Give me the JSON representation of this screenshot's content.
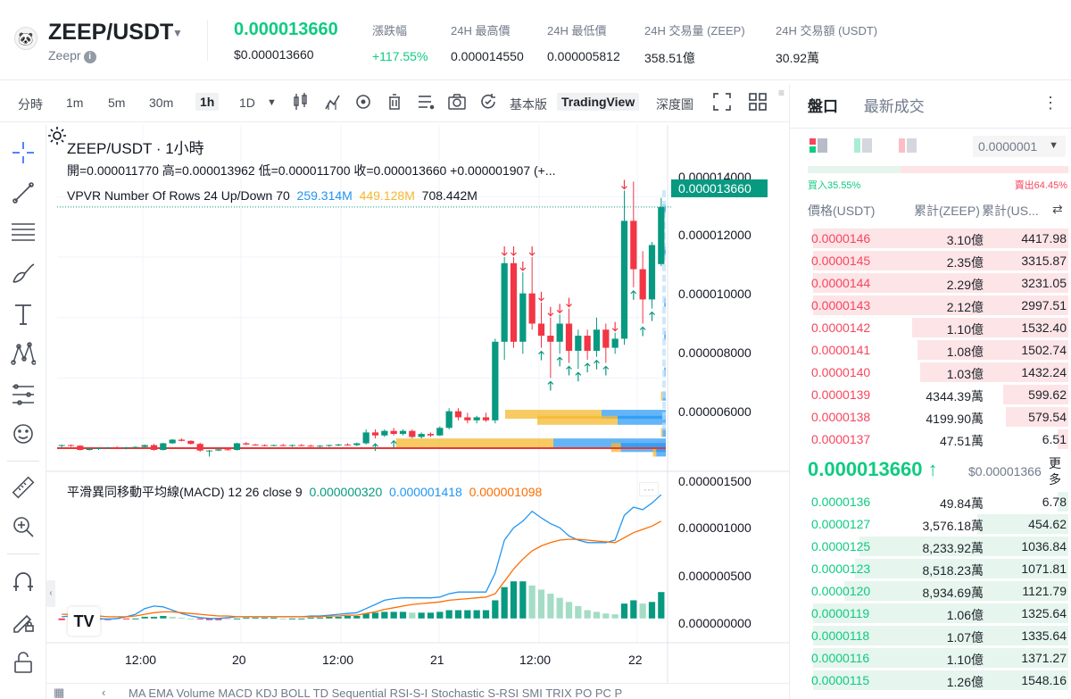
{
  "header": {
    "pair": "ZEEP/USDT",
    "sub": "Zeepr",
    "last_price": "0.000013660",
    "last_usd": "$0.000013660",
    "stats": [
      {
        "label": "漲跌幅",
        "value": "+117.55%",
        "green": true
      },
      {
        "label": "24H 最高價",
        "value": "0.000014550"
      },
      {
        "label": "24H 最低價",
        "value": "0.000005812"
      },
      {
        "label": "24H 交易量 (ZEEP)",
        "value": "358.51億"
      },
      {
        "label": "24H 交易額 (USDT)",
        "value": "30.92萬"
      }
    ]
  },
  "toolbar": {
    "intervals": [
      "分時",
      "1m",
      "5m",
      "30m",
      "1h",
      "1D"
    ],
    "active": "1h",
    "basic": "基本版",
    "tradingview": "TradingView",
    "depth": "深度圖"
  },
  "chart": {
    "title": "ZEEP/USDT · 1小時",
    "ohlc": "開=0.000011770  高=0.000013962  低=0.000011700  收=0.000013660  +0.000001907  (+...",
    "vpvr_label": "VPVR Number Of Rows 24 Up/Down 70",
    "vpvr_up": "259.314M",
    "vpvr_down": "449.128M",
    "vpvr_total": "708.442M",
    "last_tag": "0.000013660",
    "price_axis": [
      "0.000014000",
      "0.000012000",
      "0.000010000",
      "0.000008000",
      "0.000006000"
    ],
    "macd_label": "平滑異同移動平均線(MACD) 12 26 close 9",
    "macd_v1": "0.000000320",
    "macd_v2": "0.000001418",
    "macd_v3": "0.000001098",
    "macd_axis": [
      "0.000001500",
      "0.000001000",
      "0.000000500",
      "0.000000000"
    ],
    "time_axis": [
      "12:00",
      "20",
      "12:00",
      "21",
      "12:00",
      "22"
    ]
  },
  "indicators": "MA   EMA   Volume   MACD   KDJ   BOLL   TD Sequential   RSI-S-I   Stochastic   S-RSI   SMI   TRIX   PO   PC   P",
  "orderbook": {
    "tabs": [
      "盤口",
      "最新成交"
    ],
    "precision": "0.0000001",
    "buy_ratio": "買入35.55%",
    "sell_ratio": "賣出64.45%",
    "cols": {
      "price": "價格(USDT)",
      "amount": "累計(ZEEP)",
      "total": "累計(US..."
    },
    "asks": [
      {
        "p": "0.0000146",
        "a": "3.10億",
        "t": "4417.98",
        "w": 0.98
      },
      {
        "p": "0.0000145",
        "a": "2.35億",
        "t": "3315.87",
        "w": 0.98
      },
      {
        "p": "0.0000144",
        "a": "2.29億",
        "t": "3231.05",
        "w": 0.98
      },
      {
        "p": "0.0000143",
        "a": "2.12億",
        "t": "2997.51",
        "w": 0.98
      },
      {
        "p": "0.0000142",
        "a": "1.10億",
        "t": "1532.40",
        "w": 0.6
      },
      {
        "p": "0.0000141",
        "a": "1.08億",
        "t": "1502.74",
        "w": 0.58
      },
      {
        "p": "0.0000140",
        "a": "1.03億",
        "t": "1432.24",
        "w": 0.57
      },
      {
        "p": "0.0000139",
        "a": "4344.39萬",
        "t": "599.62",
        "w": 0.25
      },
      {
        "p": "0.0000138",
        "a": "4199.90萬",
        "t": "579.54",
        "w": 0.24
      },
      {
        "p": "0.0000137",
        "a": "47.51萬",
        "t": "6.51",
        "w": 0.04
      }
    ],
    "mid_price": "0.000013660 ↑",
    "mid_usd": "$0.00001366",
    "mid_more": "更多",
    "bids": [
      {
        "p": "0.0000136",
        "a": "49.84萬",
        "t": "6.78",
        "w": 0.04
      },
      {
        "p": "0.0000127",
        "a": "3,576.18萬",
        "t": "454.62",
        "w": 0.35
      },
      {
        "p": "0.0000125",
        "a": "8,233.92萬",
        "t": "1036.84",
        "w": 0.8
      },
      {
        "p": "0.0000123",
        "a": "8,518.23萬",
        "t": "1071.81",
        "w": 0.82
      },
      {
        "p": "0.0000120",
        "a": "8,934.69萬",
        "t": "1121.79",
        "w": 0.86
      },
      {
        "p": "0.0000119",
        "a": "1.06億",
        "t": "1325.64",
        "w": 0.98
      },
      {
        "p": "0.0000118",
        "a": "1.07億",
        "t": "1335.64",
        "w": 0.98
      },
      {
        "p": "0.0000116",
        "a": "1.10億",
        "t": "1371.27",
        "w": 0.98
      },
      {
        "p": "0.0000115",
        "a": "1.26億",
        "t": "1548.16",
        "w": 0.98
      }
    ]
  },
  "colors": {
    "up": "#0ecb81",
    "down": "#f6465d",
    "tv_up": "#089981",
    "tv_down": "#f23645"
  },
  "chart_data": {
    "type": "candlestick",
    "series": [
      {
        "name": "price",
        "values": [
          [
            5.75,
            5.8,
            5.7,
            5.78
          ],
          [
            5.78,
            5.8,
            5.72,
            5.76
          ],
          [
            5.76,
            5.78,
            5.6,
            5.62
          ],
          [
            5.62,
            5.68,
            5.6,
            5.66
          ],
          [
            5.66,
            5.7,
            5.62,
            5.68
          ],
          [
            5.68,
            5.72,
            5.66,
            5.7
          ],
          [
            5.7,
            5.74,
            5.66,
            5.68
          ],
          [
            5.68,
            5.72,
            5.64,
            5.7
          ],
          [
            5.7,
            5.74,
            5.68,
            5.72
          ],
          [
            5.72,
            5.8,
            5.7,
            5.78
          ],
          [
            5.78,
            5.82,
            5.6,
            5.62
          ],
          [
            5.62,
            5.86,
            5.6,
            5.84
          ],
          [
            5.84,
            5.98,
            5.82,
            5.96
          ],
          [
            5.96,
            6.0,
            5.9,
            5.92
          ],
          [
            5.92,
            5.94,
            5.8,
            5.82
          ],
          [
            5.82,
            5.86,
            5.56,
            5.6
          ],
          [
            5.6,
            5.62,
            5.4,
            5.6
          ],
          [
            5.6,
            5.66,
            5.58,
            5.64
          ],
          [
            5.64,
            5.66,
            5.6,
            5.62
          ],
          [
            5.62,
            5.86,
            5.6,
            5.84
          ],
          [
            5.84,
            5.88,
            5.78,
            5.8
          ],
          [
            5.8,
            5.82,
            5.76,
            5.78
          ],
          [
            5.78,
            5.8,
            5.74,
            5.76
          ],
          [
            5.76,
            5.8,
            5.74,
            5.78
          ],
          [
            5.78,
            5.82,
            5.74,
            5.76
          ],
          [
            5.76,
            5.8,
            5.72,
            5.78
          ],
          [
            5.78,
            5.82,
            5.74,
            5.76
          ],
          [
            5.76,
            5.8,
            5.72,
            5.74
          ],
          [
            5.74,
            5.78,
            5.7,
            5.76
          ],
          [
            5.76,
            5.8,
            5.72,
            5.78
          ],
          [
            5.78,
            5.82,
            5.74,
            5.8
          ],
          [
            5.8,
            5.84,
            5.76,
            5.78
          ],
          [
            5.78,
            5.86,
            5.74,
            5.84
          ],
          [
            5.84,
            6.3,
            5.8,
            6.2
          ],
          [
            6.2,
            6.3,
            6.0,
            6.1
          ],
          [
            6.1,
            6.3,
            6.05,
            6.25
          ],
          [
            6.25,
            6.35,
            6.1,
            6.15
          ],
          [
            6.15,
            6.3,
            6.1,
            6.25
          ],
          [
            6.25,
            6.3,
            6.0,
            6.05
          ],
          [
            6.05,
            6.2,
            6.0,
            6.15
          ],
          [
            6.15,
            6.2,
            6.05,
            6.1
          ],
          [
            6.1,
            6.4,
            6.08,
            6.35
          ],
          [
            6.35,
            7.0,
            6.3,
            6.9
          ],
          [
            6.9,
            7.0,
            6.6,
            6.7
          ],
          [
            6.7,
            6.85,
            6.5,
            6.6
          ],
          [
            6.6,
            6.75,
            6.5,
            6.7
          ],
          [
            6.7,
            6.85,
            6.55,
            6.6
          ],
          [
            6.6,
            9.3,
            6.5,
            9.2
          ],
          [
            9.2,
            12.0,
            8.6,
            11.8
          ],
          [
            11.8,
            12.0,
            9.0,
            9.2
          ],
          [
            9.2,
            11.5,
            8.8,
            10.8
          ],
          [
            10.8,
            12.0,
            9.6,
            9.8
          ],
          [
            9.8,
            10.5,
            9.0,
            9.4
          ],
          [
            9.4,
            10.0,
            8.0,
            9.2
          ],
          [
            9.2,
            10.1,
            8.8,
            9.8
          ],
          [
            9.8,
            10.3,
            8.5,
            8.9
          ],
          [
            8.9,
            9.6,
            8.3,
            9.4
          ],
          [
            9.4,
            9.6,
            8.6,
            8.9
          ],
          [
            8.9,
            10.0,
            8.7,
            9.6
          ],
          [
            9.6,
            9.8,
            8.5,
            9.0
          ],
          [
            9.0,
            9.5,
            8.8,
            9.3
          ],
          [
            9.3,
            14.2,
            9.1,
            13.2
          ],
          [
            13.2,
            14.5,
            11.0,
            11.6
          ],
          [
            11.6,
            12.2,
            9.8,
            10.6
          ],
          [
            10.6,
            12.5,
            10.3,
            12.4
          ],
          [
            11.77,
            13.96,
            11.7,
            13.66
          ]
        ]
      }
    ],
    "macd": {
      "hist": [
        -0.02,
        -0.02,
        -0.03,
        -0.03,
        -0.02,
        -0.02,
        -0.01,
        -0.01,
        0.0,
        0.02,
        0.02,
        0.03,
        0.02,
        0.01,
        0.0,
        -0.01,
        -0.02,
        -0.02,
        -0.01,
        0.0,
        0.01,
        0.01,
        0.01,
        0.01,
        0.0,
        0.0,
        0.0,
        0.01,
        0.01,
        0.02,
        0.02,
        0.03,
        0.03,
        0.06,
        0.07,
        0.08,
        0.08,
        0.08,
        0.07,
        0.07,
        0.07,
        0.08,
        0.1,
        0.1,
        0.1,
        0.1,
        0.1,
        0.22,
        0.38,
        0.45,
        0.45,
        0.4,
        0.35,
        0.3,
        0.25,
        0.2,
        0.15,
        0.1,
        0.08,
        0.06,
        0.05,
        0.18,
        0.22,
        0.18,
        0.2,
        0.32
      ],
      "macd_line": [
        0.02,
        0.03,
        0.02,
        0.01,
        0.0,
        -0.01,
        0.0,
        0.02,
        0.05,
        0.12,
        0.15,
        0.14,
        0.1,
        0.06,
        0.03,
        0.01,
        0.0,
        0.0,
        0.01,
        0.02,
        0.02,
        0.02,
        0.02,
        0.02,
        0.02,
        0.02,
        0.02,
        0.03,
        0.03,
        0.04,
        0.05,
        0.06,
        0.07,
        0.12,
        0.17,
        0.22,
        0.24,
        0.25,
        0.25,
        0.25,
        0.25,
        0.26,
        0.3,
        0.32,
        0.32,
        0.32,
        0.32,
        0.55,
        0.95,
        1.1,
        1.18,
        1.3,
        1.22,
        1.15,
        1.1,
        1.0,
        0.95,
        0.92,
        0.92,
        0.92,
        0.95,
        1.25,
        1.35,
        1.32,
        1.4,
        1.5
      ],
      "signal_line": [
        0.05,
        0.05,
        0.05,
        0.04,
        0.03,
        0.02,
        0.02,
        0.02,
        0.03,
        0.05,
        0.07,
        0.08,
        0.08,
        0.07,
        0.06,
        0.05,
        0.04,
        0.03,
        0.03,
        0.02,
        0.02,
        0.02,
        0.02,
        0.02,
        0.02,
        0.02,
        0.02,
        0.02,
        0.02,
        0.03,
        0.03,
        0.04,
        0.04,
        0.06,
        0.08,
        0.11,
        0.13,
        0.15,
        0.17,
        0.18,
        0.19,
        0.2,
        0.22,
        0.23,
        0.24,
        0.25,
        0.26,
        0.3,
        0.45,
        0.6,
        0.72,
        0.82,
        0.88,
        0.92,
        0.95,
        0.96,
        0.96,
        0.95,
        0.94,
        0.93,
        0.92,
        0.98,
        1.04,
        1.08,
        1.12,
        1.18
      ]
    },
    "ylim": [
      5.0,
      14.6
    ],
    "ylabel": ""
  }
}
